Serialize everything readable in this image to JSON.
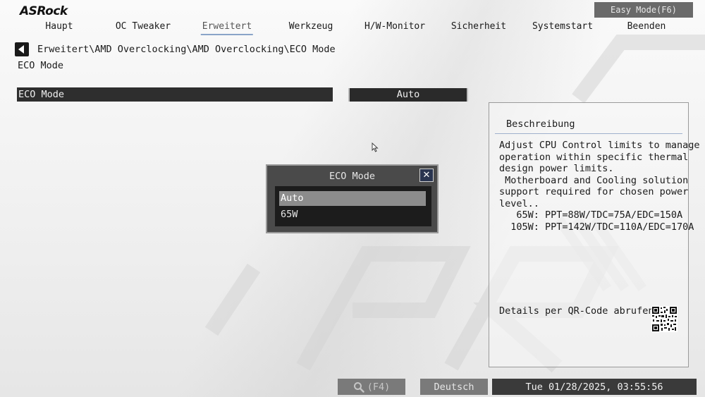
{
  "header": {
    "logo_text": "ASRock",
    "mode_button": "Easy Mode(F6)"
  },
  "tabs": [
    {
      "label": "Haupt",
      "active": false
    },
    {
      "label": "OC Tweaker",
      "active": false
    },
    {
      "label": "Erweitert",
      "active": true
    },
    {
      "label": "Werkzeug",
      "active": false
    },
    {
      "label": "H/W-Monitor",
      "active": false
    },
    {
      "label": "Sicherheit",
      "active": false
    },
    {
      "label": "Systemstart",
      "active": false
    },
    {
      "label": "Beenden",
      "active": false
    }
  ],
  "breadcrumb": "Erweitert\\AMD Overclocking\\AMD Overclocking\\ECO Mode",
  "page_title": "ECO Mode",
  "setting": {
    "label": "ECO Mode",
    "value": "Auto"
  },
  "description": {
    "title": "Beschreibung",
    "text": "Adjust CPU Control limits to manage\noperation within specific thermal\ndesign power limits.\n Motherboard and Cooling solution\nsupport required for chosen power\nlevel..\n   65W: PPT=88W/TDC=75A/EDC=150A\n  105W: PPT=142W/TDC=110A/EDC=170A",
    "qr_label": "Details per QR-Code abrufen"
  },
  "modal": {
    "title": "ECO Mode",
    "options": [
      {
        "label": "Auto",
        "selected": true
      },
      {
        "label": "65W",
        "selected": false
      }
    ]
  },
  "footer": {
    "search_label": "(F4)",
    "language": "Deutsch",
    "datetime": "Tue 01/28/2025, 03:55:56"
  },
  "colors": {
    "accent_underline": "#8aa4c8",
    "row_background": "#2e2e2e",
    "modal_background": "#4a4a4a"
  }
}
